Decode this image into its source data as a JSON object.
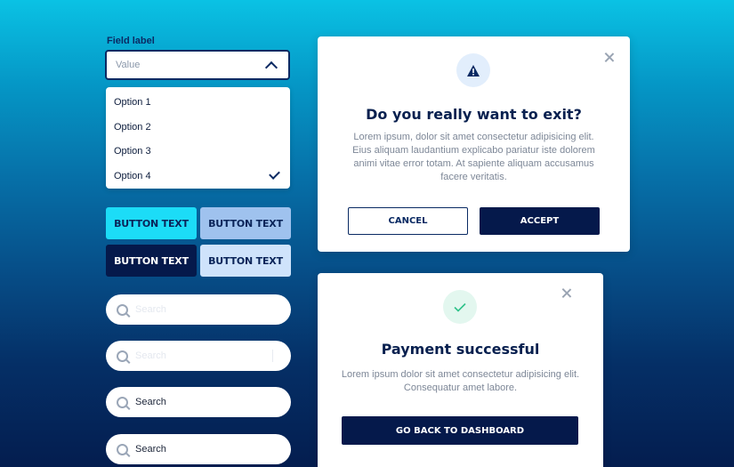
{
  "select": {
    "label": "Field label",
    "value": "Value",
    "options": [
      {
        "label": "Option 1"
      },
      {
        "label": "Option 2"
      },
      {
        "label": "Option 3"
      },
      {
        "label": "Option 4",
        "selected": true
      }
    ]
  },
  "buttons": [
    {
      "label": "BUTTON TEXT",
      "color": "#1cdcf7"
    },
    {
      "label": "BUTTON TEXT",
      "color": "#9fc2ee"
    },
    {
      "label": "BUTTON TEXT",
      "color": "#05194b"
    },
    {
      "label": "BUTTON TEXT",
      "color": "#cfe3fb"
    }
  ],
  "searches": [
    {
      "placeholder": "Search"
    },
    {
      "placeholder": "Search"
    },
    {
      "placeholder": "Search"
    },
    {
      "placeholder": "Search"
    }
  ],
  "exit_modal": {
    "title": "Do you really want to exit?",
    "body": "Lorem ipsum, dolor sit amet consectetur adipisicing elit. Eius aliquam laudantium explicabo pariatur iste dolorem animi vitae error totam. At sapiente aliquam accusamus facere veritatis.",
    "cancel_label": "CANCEL",
    "accept_label": "ACCEPT",
    "icon": "warning-icon"
  },
  "payment_modal": {
    "title": "Payment successful",
    "body": "Lorem ipsum dolor sit amet consectetur adipisicing elit. Consequatur amet labore.",
    "button_label": "GO BACK TO DASHBOARD",
    "icon": "checkmark-icon"
  },
  "colors": {
    "navy": "#05194b",
    "cyan": "#1cdcf7"
  }
}
